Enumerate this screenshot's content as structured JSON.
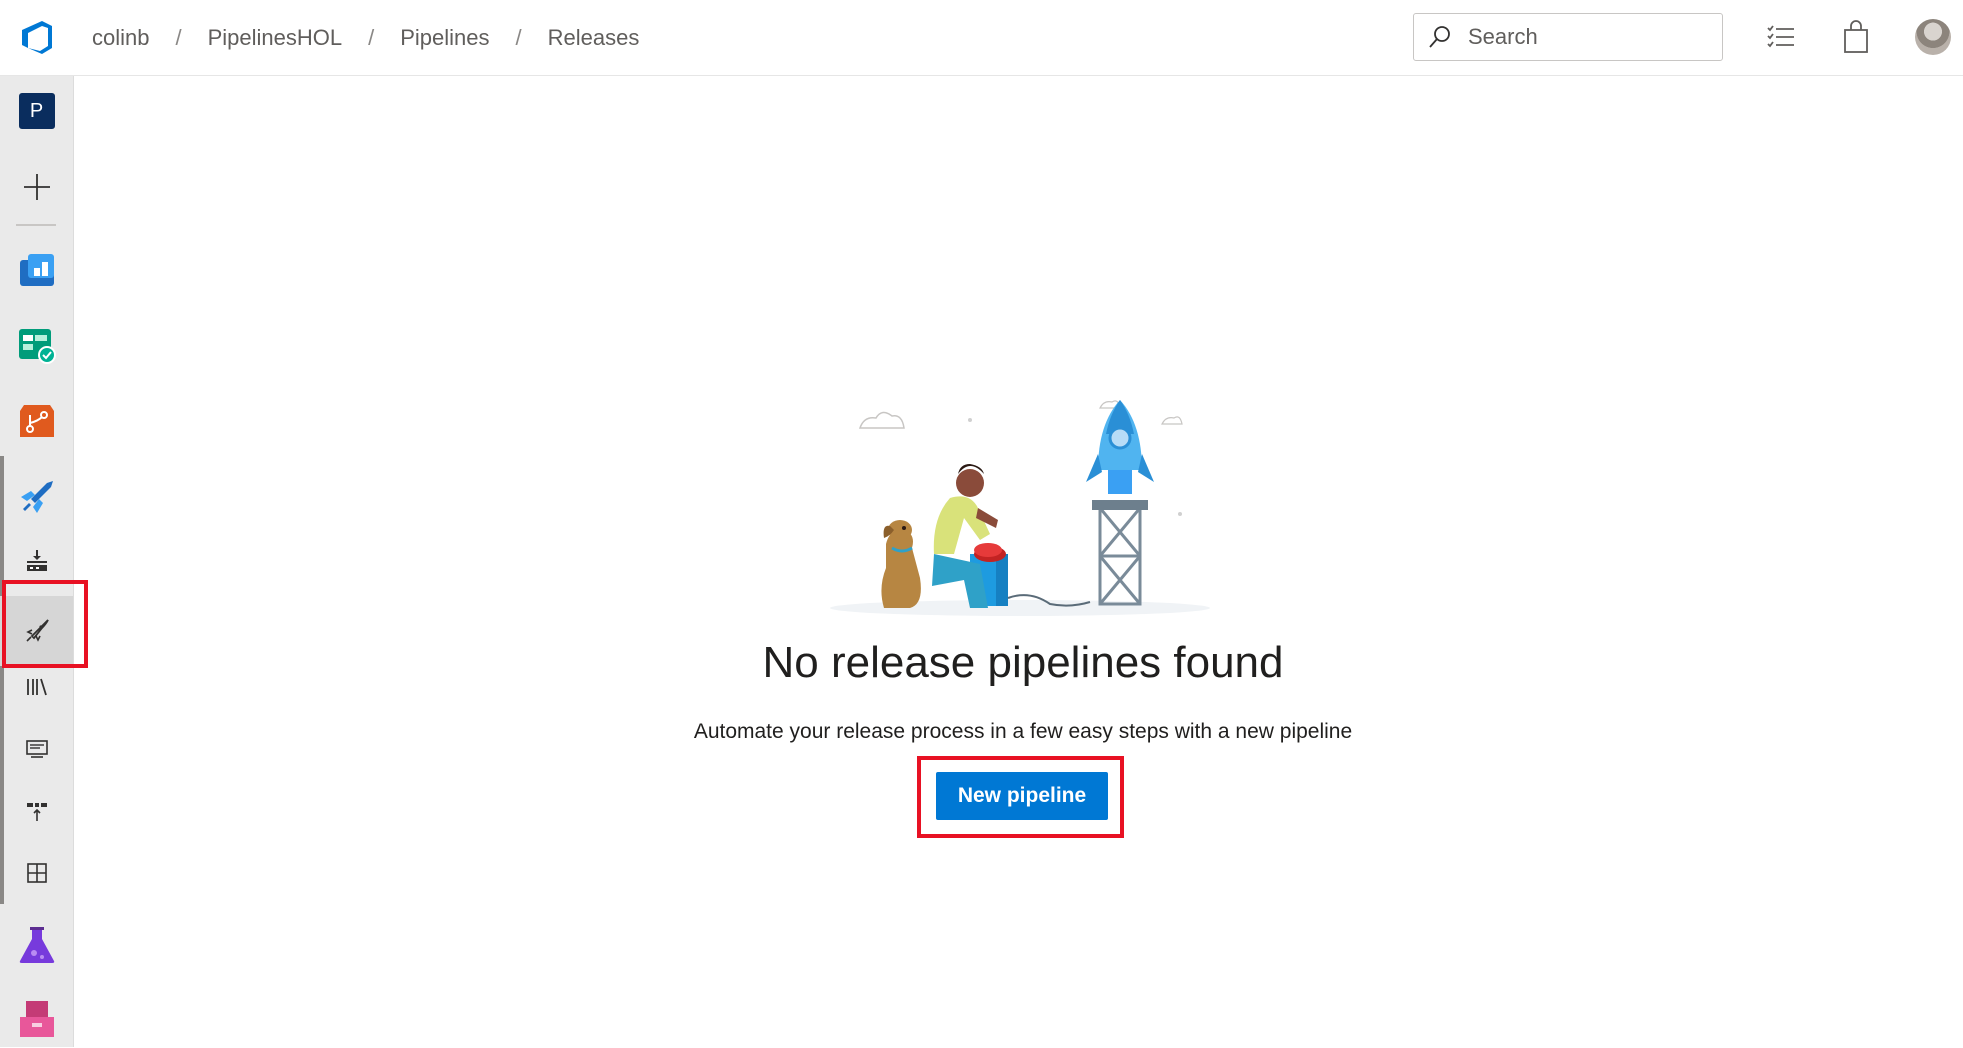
{
  "header": {
    "breadcrumbs": [
      "colinb",
      "PipelinesHOL",
      "Pipelines",
      "Releases"
    ],
    "search_placeholder": "Search",
    "icons": [
      "azure-devops-logo",
      "search-icon",
      "task-list-icon",
      "shopping-bag-icon",
      "avatar"
    ]
  },
  "sidebar": {
    "project_initial": "P",
    "items": [
      {
        "name": "project",
        "icon": "project-tile"
      },
      {
        "name": "new",
        "icon": "plus-icon"
      },
      {
        "name": "overview",
        "icon": "overview-icon"
      },
      {
        "name": "boards",
        "icon": "boards-icon"
      },
      {
        "name": "repos",
        "icon": "repos-icon"
      },
      {
        "name": "pipelines",
        "icon": "pipelines-icon"
      },
      {
        "name": "builds",
        "icon": "builds-icon"
      },
      {
        "name": "releases",
        "icon": "rocket-icon",
        "selected": true
      },
      {
        "name": "library",
        "icon": "library-icon"
      },
      {
        "name": "task-groups",
        "icon": "task-groups-icon"
      },
      {
        "name": "deployment-groups",
        "icon": "deployment-groups-icon"
      },
      {
        "name": "xaml",
        "icon": "grid-icon"
      },
      {
        "name": "test-plans",
        "icon": "flask-icon"
      },
      {
        "name": "artifacts",
        "icon": "artifacts-icon"
      }
    ]
  },
  "main": {
    "title": "No release pipelines found",
    "subtitle": "Automate your release process in a few easy steps with a new pipeline",
    "button_label": "New pipeline"
  },
  "colors": {
    "accent": "#0078d4",
    "highlight": "#e81123",
    "nav_bg": "#eaeaea"
  }
}
